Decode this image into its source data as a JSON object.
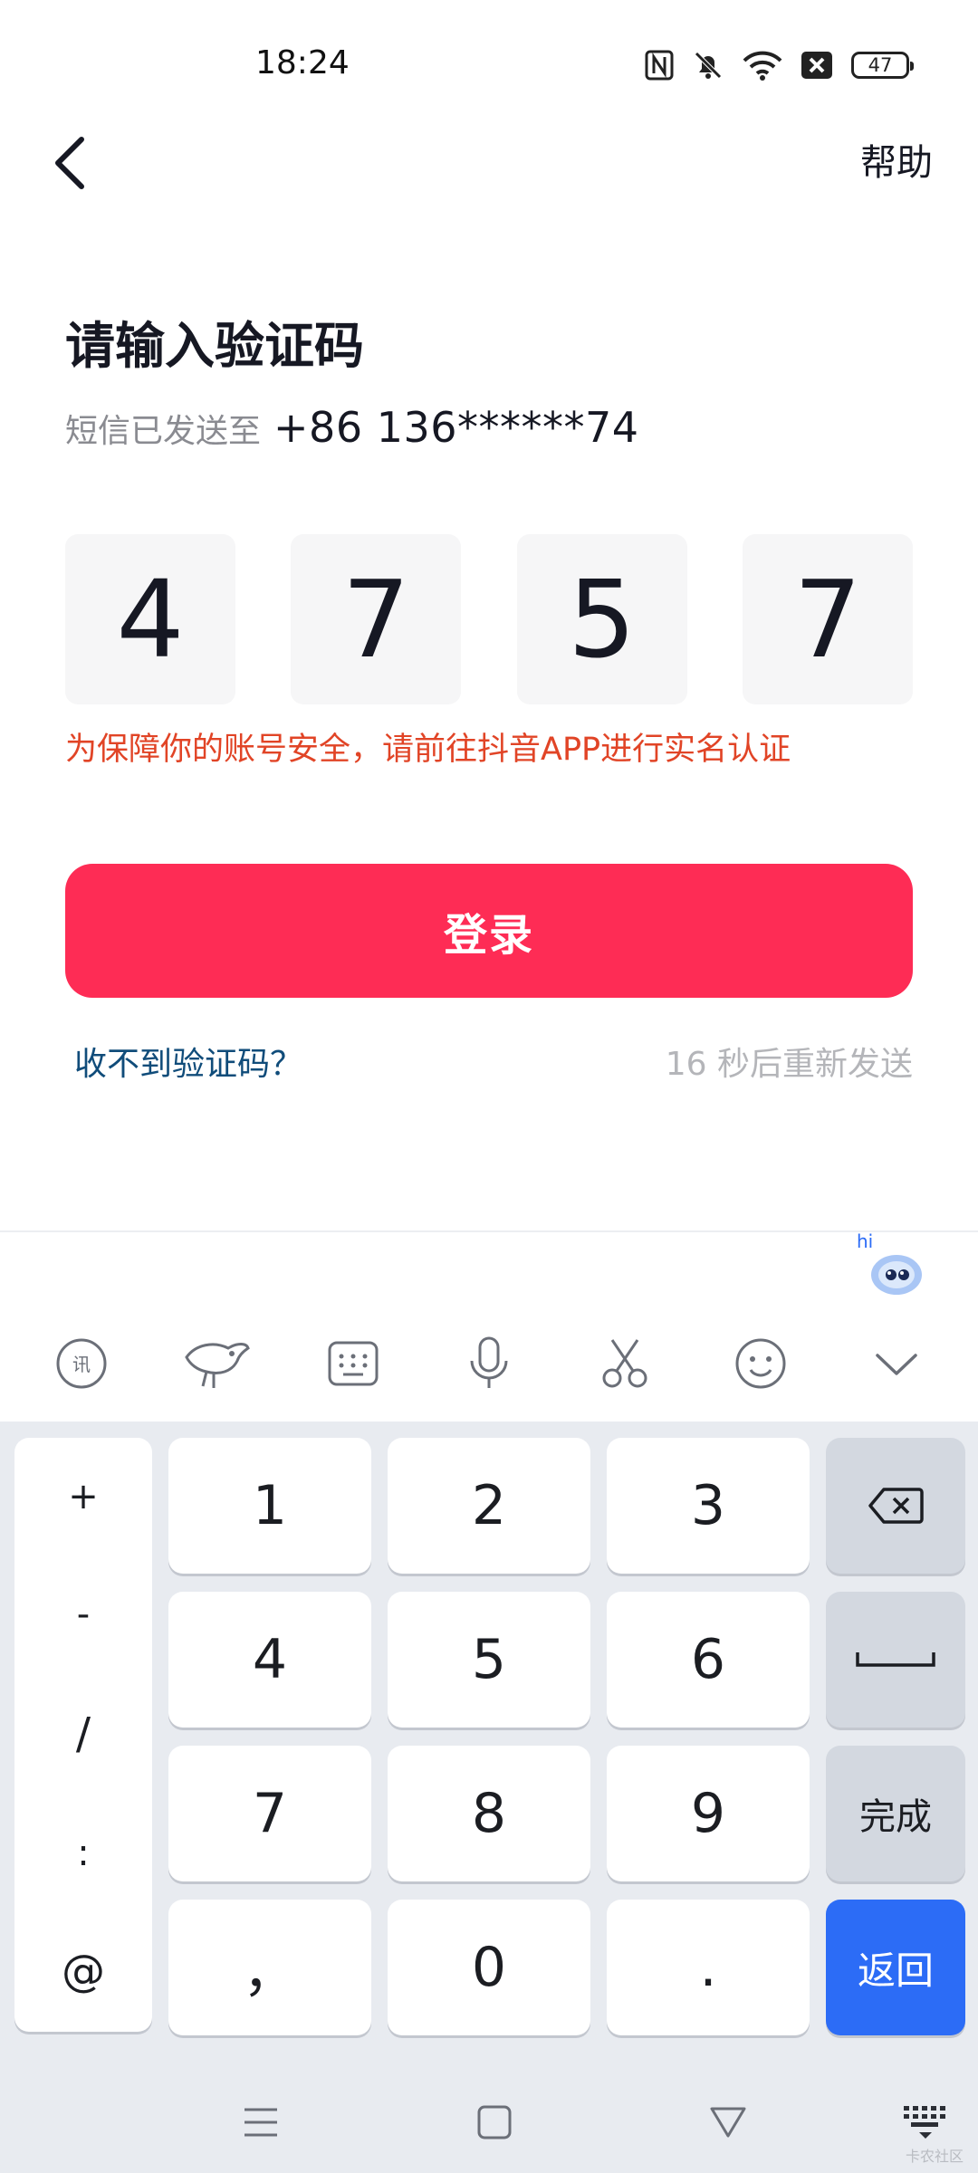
{
  "status_bar": {
    "time": "18:24",
    "battery": "47",
    "icons": [
      "nfc-icon",
      "bell-off-icon",
      "wifi-icon",
      "sim-off-icon",
      "battery-icon"
    ]
  },
  "header": {
    "back_icon": "chevron-left-icon",
    "help_label": "帮助"
  },
  "main": {
    "title": "请输入验证码",
    "sent_label": "短信已发送至",
    "phone": "+86 136******74",
    "code_digits": [
      "4",
      "7",
      "5",
      "7"
    ],
    "warning": "为保障你的账号安全，请前往抖音APP进行实名认证",
    "login_label": "登录",
    "no_code_label": "收不到验证码？",
    "resend_label": "16 秒后重新发送"
  },
  "keyboard": {
    "assistant_bubble": "hi",
    "toolbar": [
      "voice-recognition-icon",
      "mascot-icon",
      "keyboard-layout-icon",
      "microphone-icon",
      "scissors-icon",
      "emoji-icon",
      "chevron-down-icon"
    ],
    "symbols": [
      "+",
      "-",
      "/",
      ":",
      "@"
    ],
    "rows": [
      [
        "1",
        "2",
        "3"
      ],
      [
        "4",
        "5",
        "6"
      ],
      [
        "7",
        "8",
        "9"
      ],
      [
        "，",
        "0",
        "."
      ]
    ],
    "side_keys": {
      "backspace_icon": "backspace-icon",
      "space_icon": "space-icon",
      "done_label": "完成",
      "return_label": "返回"
    },
    "nav": [
      "menu-icon",
      "home-icon",
      "back-triangle-icon",
      "keyboard-hide-icon"
    ],
    "watermark": "卡农社区"
  },
  "colors": {
    "accent": "#fe2c55",
    "warning": "#e14426",
    "link": "#104c7a",
    "return_key": "#2c6cf6"
  }
}
